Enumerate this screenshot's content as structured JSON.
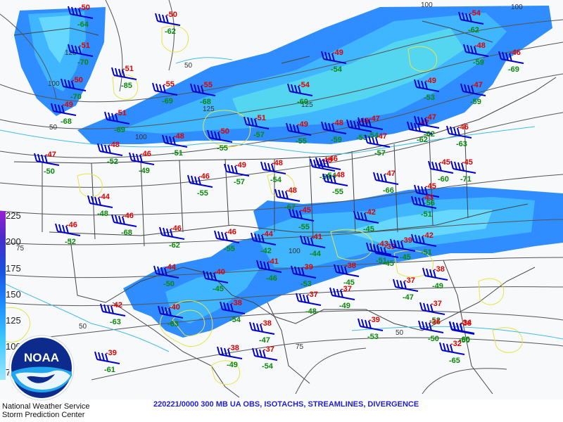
{
  "product": {
    "title": "220221/0000 300 MB UA OBS, ISOTACHS, STREAMLINES, DIVERGENCE",
    "org_line1": "National Weather Service",
    "org_line2": "Storm Prediction Center",
    "logo_text": "NOAA"
  },
  "colorbar": {
    "labels": [
      "225",
      "200",
      "175",
      "150",
      "125",
      "100",
      "75"
    ]
  },
  "contour_labels": [
    "100",
    "100",
    "100",
    "100",
    "125",
    "125",
    "125",
    "50",
    "50",
    "50",
    "50",
    "75",
    "75",
    "100"
  ],
  "stations": [
    {
      "t": "-50",
      "d": "-64"
    },
    {
      "t": "-50",
      "d": "-62"
    },
    {
      "t": "-51",
      "d": "-70"
    },
    {
      "t": "-50",
      "d": "-70"
    },
    {
      "t": "-49",
      "d": "-68"
    },
    {
      "t": "-51",
      "d": "-85"
    },
    {
      "t": "-55",
      "d": "-69"
    },
    {
      "t": "-55",
      "d": "-68"
    },
    {
      "t": "-51",
      "d": "-69"
    },
    {
      "t": "-51",
      "d": "-57"
    },
    {
      "t": "-48",
      "d": "-51"
    },
    {
      "t": "-50",
      "d": "-55"
    },
    {
      "t": "-48",
      "d": "-52"
    },
    {
      "t": "-46",
      "d": "-49"
    },
    {
      "t": "-47",
      "d": "-50"
    },
    {
      "t": "-49",
      "d": "-55"
    },
    {
      "t": "-48",
      "d": "-59"
    },
    {
      "t": "-48",
      "d": "-53"
    },
    {
      "t": "-47",
      "d": "-57"
    },
    {
      "t": "-47",
      "d": "-62"
    },
    {
      "t": "-46",
      "d": "-63"
    },
    {
      "t": "-54",
      "d": "-60"
    },
    {
      "t": "-49",
      "d": "-54"
    },
    {
      "t": "-47",
      "d": "-54"
    },
    {
      "t": "-49",
      "d": "-53"
    },
    {
      "t": "-48",
      "d": "-58"
    },
    {
      "t": "-54",
      "d": "-62"
    },
    {
      "t": "-48",
      "d": "-59"
    },
    {
      "t": "-47",
      "d": "-59"
    },
    {
      "t": "-45",
      "d": "-60"
    },
    {
      "t": "-46",
      "d": "-69"
    },
    {
      "t": "-49",
      "d": "-57"
    },
    {
      "t": "-48",
      "d": "-54"
    },
    {
      "t": "-48",
      "d": "-67"
    },
    {
      "t": "-46",
      "d": "-54"
    },
    {
      "t": "-48",
      "d": "-55"
    },
    {
      "t": "-47",
      "d": "-66"
    },
    {
      "t": "-45",
      "d": "-56"
    },
    {
      "t": "-45",
      "d": "-71"
    },
    {
      "t": "-44",
      "d": "-48"
    },
    {
      "t": "-46",
      "d": "-68"
    },
    {
      "t": "-46",
      "d": "-52"
    },
    {
      "t": "-46",
      "d": "-62"
    },
    {
      "t": "-46",
      "d": "-55"
    },
    {
      "t": "-46",
      "d": "-55"
    },
    {
      "t": "-45",
      "d": "-55"
    },
    {
      "t": "-43",
      "d": "-51"
    },
    {
      "t": "-42",
      "d": "-45"
    },
    {
      "t": "-43",
      "d": "-51"
    },
    {
      "t": "-42",
      "d": "-51"
    },
    {
      "t": "-44",
      "d": "-42"
    },
    {
      "t": "-41",
      "d": "-44"
    },
    {
      "t": "-39",
      "d": "-53"
    },
    {
      "t": "-38",
      "d": "-45"
    },
    {
      "t": "-39",
      "d": "-45"
    },
    {
      "t": "-41",
      "d": "-46"
    },
    {
      "t": "-40",
      "d": "-45"
    },
    {
      "t": "-44",
      "d": "-50"
    },
    {
      "t": "-39",
      "d": "-45"
    },
    {
      "t": "-38",
      "d": "-49"
    },
    {
      "t": "-37",
      "d": "-47"
    },
    {
      "t": "-42",
      "d": "-63"
    },
    {
      "t": "-40",
      "d": "-63"
    },
    {
      "t": "-38",
      "d": "-54"
    },
    {
      "t": "-37",
      "d": "-48"
    },
    {
      "t": "-37",
      "d": "-49"
    },
    {
      "t": "-37",
      "d": "-52"
    },
    {
      "t": "-38",
      "d": "-50"
    },
    {
      "t": "-38",
      "d": "-47"
    },
    {
      "t": "-37",
      "d": "-54"
    },
    {
      "t": "-39",
      "d": "-61"
    },
    {
      "t": "-36",
      "d": "-50"
    },
    {
      "t": "-34",
      "d": "-60"
    },
    {
      "t": "-32",
      "d": "-65"
    },
    {
      "t": "-38",
      "d": "-49"
    },
    {
      "t": "-47",
      "d": "-62"
    },
    {
      "t": "-39",
      "d": "-53"
    }
  ]
}
